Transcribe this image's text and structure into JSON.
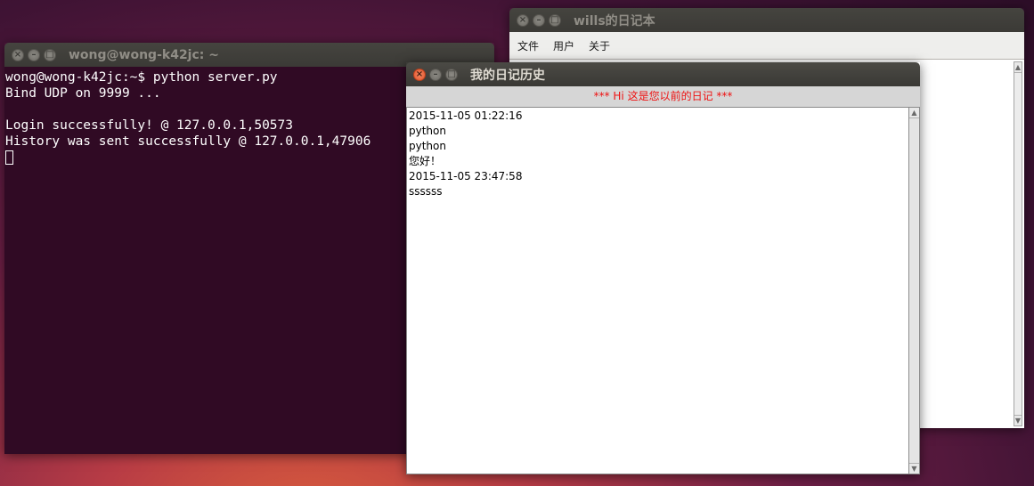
{
  "terminal": {
    "title": "wong@wong-k42jc: ~",
    "lines": [
      "wong@wong-k42jc:~$ python server.py",
      "Bind UDP on 9999 ...",
      "",
      "Login successfully! @ 127.0.0.1,50573",
      "History was sent successfully @ 127.0.0.1,47906"
    ]
  },
  "diary_window": {
    "title": "wills的日记本",
    "menu": [
      "文件",
      "用户",
      "关于"
    ]
  },
  "history_window": {
    "title": "我的日记历史",
    "header": "*** Hi 这是您以前的日记 ***",
    "entries": [
      "2015-11-05 01:22:16",
      "python",
      "python",
      "您好！",
      "2015-11-05 23:47:58",
      "ssssss"
    ]
  },
  "window_buttons": {
    "close": "×",
    "minimize": "–",
    "maximize": "□"
  },
  "colors": {
    "terminal_bg": "#300a24",
    "header_text": "#ee1111",
    "close_active": "#e0512b"
  }
}
